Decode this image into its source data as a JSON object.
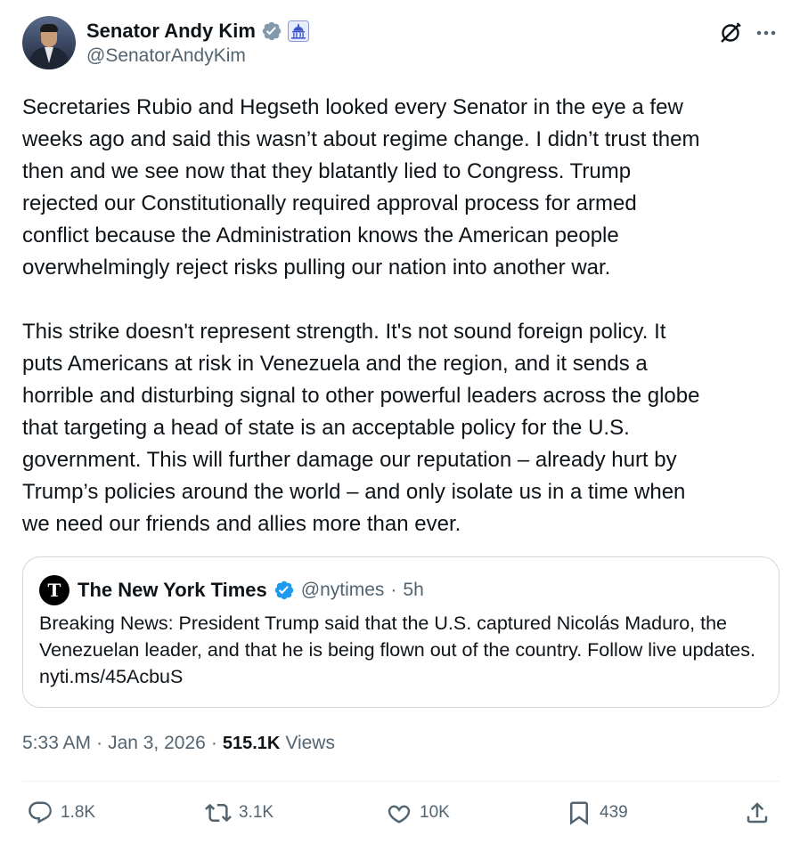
{
  "author": {
    "display_name": "Senator Andy Kim",
    "handle": "@SenatorAndyKim",
    "verified_color": "#829aab",
    "affiliate_icon": "capitol-icon"
  },
  "tweet": {
    "text": "Secretaries Rubio and Hegseth looked every Senator in the eye a few\nweeks ago and said this wasn’t about regime change. I didn’t trust them\nthen and we see now that they blatantly lied to Congress. Trump\nrejected our Constitutionally required approval process for armed\nconflict because the Administration knows the American people\noverwhelmingly reject risks pulling our nation into another war.\n\nThis strike doesn't represent strength. It's not sound foreign policy. It\nputs Americans at risk in Venezuela and the region, and it sends a\nhorrible and disturbing signal to other powerful leaders across the globe\nthat targeting a head of state is an acceptable policy for the U.S.\ngovernment. This will further damage our reputation – already hurt by\nTrump’s policies around the world – and only isolate us in a time when\nwe need our friends and allies more than ever."
  },
  "quote": {
    "display_name": "The New York Times",
    "handle": "@nytimes",
    "separator": "·",
    "time": "5h",
    "logo_letter": "T",
    "verified_color": "#1d9bf0",
    "text": "Breaking News: President Trump said that the U.S. captured Nicolás Maduro, the Venezuelan leader, and that he is being flown out of the country. Follow live updates. nyti.ms/45AcbuS"
  },
  "meta": {
    "time": "5:33 AM",
    "dot1": "·",
    "date": "Jan 3, 2026",
    "dot2": "·",
    "views_count": "515.1K",
    "views_label": "Views"
  },
  "actions": {
    "replies": "1.8K",
    "reposts": "3.1K",
    "likes": "10K",
    "bookmarks": "439"
  },
  "colors": {
    "text_primary": "#0f1419",
    "text_secondary": "#536471",
    "border": "#cfd9de",
    "blue_check": "#1d9bf0",
    "gray_check": "#829aab"
  }
}
